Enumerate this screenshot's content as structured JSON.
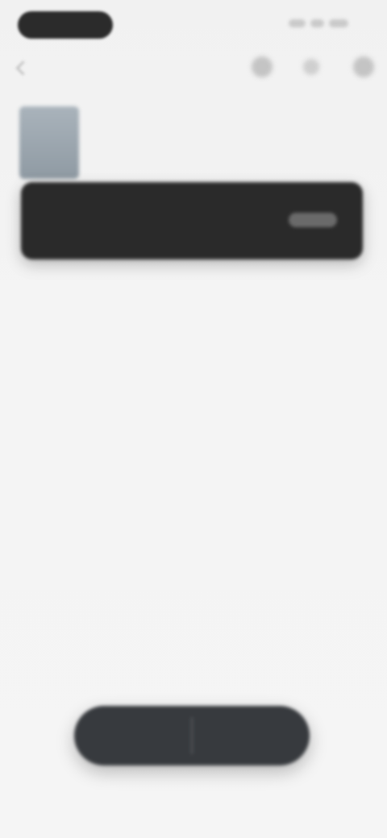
{
  "status_bar": {
    "pill_label": "",
    "right_text": ""
  },
  "top_bar": {
    "back_label": "",
    "icons": [
      "add-icon",
      "share-icon",
      "more-icon"
    ]
  },
  "track": {
    "title": ""
  },
  "card": {
    "text": "",
    "button_label": ""
  },
  "bottom_control": {
    "left_label": "",
    "right_label": ""
  },
  "colors": {
    "background": "#f5f5f5",
    "card": "#2a2a2a",
    "bottom_control": "#373a3e",
    "status_pill": "#2b2b2b"
  }
}
